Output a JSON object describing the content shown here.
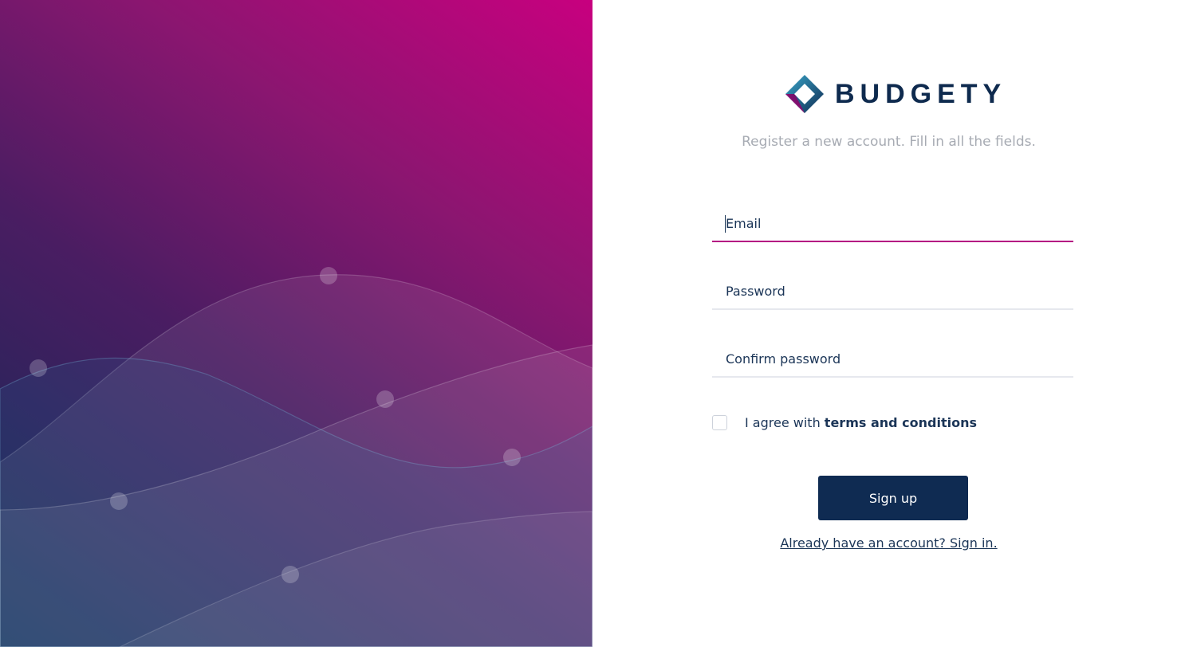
{
  "brand": {
    "name": "BUDGETY",
    "logo_icon": "diamond-logo-icon",
    "colors": {
      "navy": "#0f2b52",
      "magenta": "#c8007f",
      "text": "#1b3557",
      "muted": "#a7abb3"
    }
  },
  "register": {
    "subtitle": "Register a new account. Fill in all the fields.",
    "fields": {
      "email_placeholder": "Email",
      "password_placeholder": "Password",
      "confirm_password_placeholder": "Confirm password"
    },
    "agree_prefix": "I agree with ",
    "agree_link": "terms and conditions",
    "submit_label": "Sign up",
    "signin_link": "Already have an account? Sign in."
  }
}
